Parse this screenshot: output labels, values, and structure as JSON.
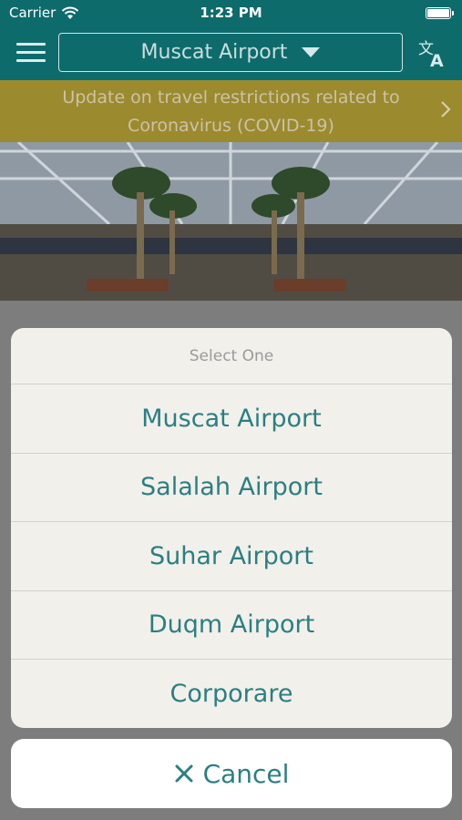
{
  "status_bar": {
    "carrier": "Carrier",
    "time": "1:23 PM",
    "battery_level": 1.0
  },
  "header": {
    "selected_airport": "Muscat Airport",
    "menu_icon": "hamburger-menu-icon",
    "language_icon": "translate-icon"
  },
  "banner": {
    "text": "Update on travel restrictions related to Coronavirus (COVID-19)",
    "chevron_icon": "chevron-right-icon"
  },
  "action_sheet": {
    "title": "Select One",
    "options": [
      {
        "label": "Muscat Airport"
      },
      {
        "label": "Salalah Airport"
      },
      {
        "label": "Suhar Airport"
      },
      {
        "label": "Duqm Airport"
      },
      {
        "label": "Corporare"
      }
    ],
    "cancel_label": "Cancel",
    "cancel_icon": "close-icon"
  },
  "colors": {
    "header_bg": "#0e6b6c",
    "banner_bg": "#9c8a2e",
    "accent_text": "#2b7f82",
    "sheet_bg": "#f2f0ea"
  }
}
